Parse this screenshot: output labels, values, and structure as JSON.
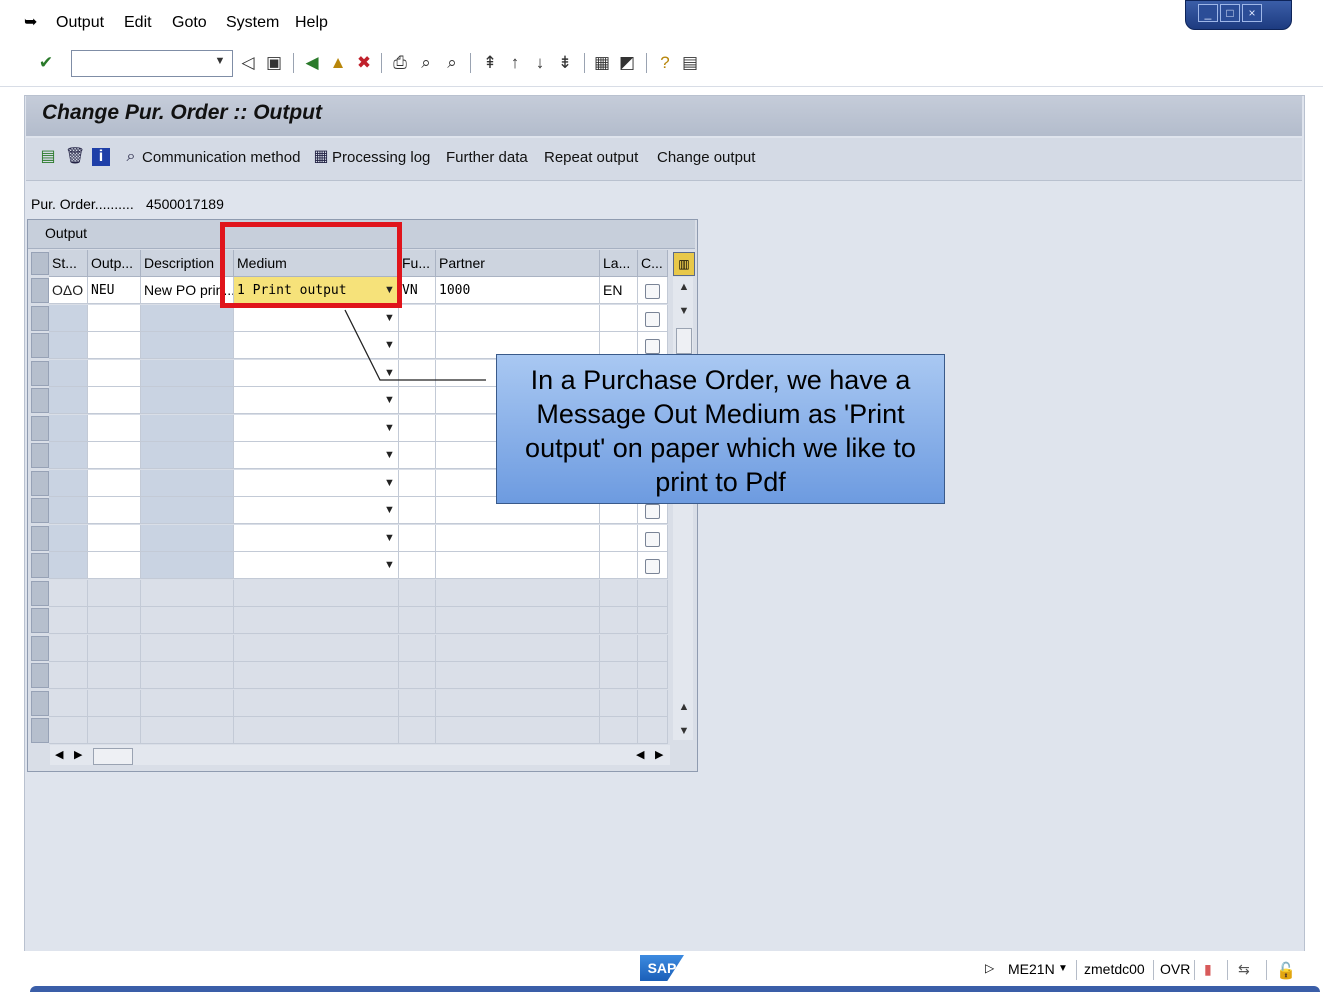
{
  "menu": {
    "items": [
      {
        "label": "Output"
      },
      {
        "label": "Edit"
      },
      {
        "label": "Goto"
      },
      {
        "label": "System"
      },
      {
        "label": "Help"
      }
    ]
  },
  "toolbar": {
    "command_field": "",
    "icons": [
      "enter-icon",
      "back-icon",
      "save-icon",
      "green-back-icon",
      "exit-icon",
      "cancel-icon",
      "print-icon",
      "find-icon",
      "find-next-icon",
      "first-page-icon",
      "previous-page-icon",
      "next-page-icon",
      "last-page-icon",
      "create-session-icon",
      "shortcut-icon",
      "help-icon",
      "layout-icon"
    ]
  },
  "window": {
    "title": "Change Pur. Order :: Output"
  },
  "app_toolbar": {
    "communication_method": "Communication method",
    "processing_log": "Processing log",
    "further_data": "Further data",
    "repeat_output": "Repeat output",
    "change_output": "Change output"
  },
  "po": {
    "label": "Pur. Order..........",
    "value": "4500017189"
  },
  "table": {
    "title": "Output",
    "headers": [
      "St...",
      "Outp...",
      "Description",
      "Medium",
      "Fu...",
      "Partner",
      "La...",
      "C..."
    ],
    "rows": [
      {
        "status": "OΔO",
        "output": "NEU",
        "description": "New PO prin...",
        "medium": "1 Print output",
        "function": "VN",
        "partner": "1000",
        "language": "EN"
      }
    ]
  },
  "callout": {
    "text": "In a Purchase Order, we have a Message Out Medium as 'Print output' on paper which we like to print to Pdf"
  },
  "status": {
    "logo": "SAP",
    "transaction": "ME21N",
    "server": "zmetdc00",
    "mode": "OVR"
  },
  "colors": {
    "highlight": "#e0141b",
    "callout_top": "#a9c8f2",
    "callout_bottom": "#6d9be0",
    "medium_cell": "#f6e27a"
  }
}
